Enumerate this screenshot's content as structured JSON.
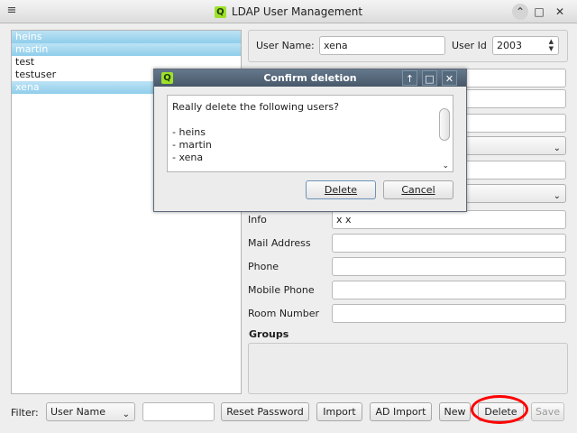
{
  "window": {
    "title": "LDAP User Management",
    "menu_glyph": "≡",
    "logo_letter": "Q",
    "controls": {
      "up": "⌃",
      "maximize": "□",
      "close": "✕"
    }
  },
  "userlist": {
    "items": [
      {
        "label": "heins",
        "selected": true
      },
      {
        "label": "martin",
        "selected": true
      },
      {
        "label": "test",
        "selected": false
      },
      {
        "label": "testuser",
        "selected": false
      },
      {
        "label": "xena",
        "selected": true
      }
    ]
  },
  "form": {
    "user_name_label": "User Name:",
    "user_name_value": "xena",
    "user_id_label": "User Id",
    "user_id_value": "2003",
    "info_label": "Info",
    "info_value": "x x",
    "mail_label": "Mail Address",
    "phone_label": "Phone",
    "mobile_label": "Mobile Phone",
    "room_label": "Room Number",
    "groups_label": "Groups"
  },
  "bottombar": {
    "filter_label": "Filter:",
    "filter_select": "User Name",
    "reset_password": "Reset Password",
    "import": "Import",
    "ad_import": "AD Import",
    "new": "New",
    "delete": "Delete",
    "save": "Save"
  },
  "dialog": {
    "title": "Confirm deletion",
    "logo_letter": "Q",
    "message": "Really delete the following users?",
    "users": [
      "- heins",
      "- martin",
      "- xena"
    ],
    "delete_button": "Delete",
    "cancel_button": "Cancel",
    "controls": {
      "up": "↑",
      "maximize": "□",
      "close": "✕"
    }
  },
  "colors": {
    "selection": "#8fcdea",
    "dialog_title": "#475869",
    "annotation": "#ff0000",
    "logo": "#9ee12b"
  }
}
